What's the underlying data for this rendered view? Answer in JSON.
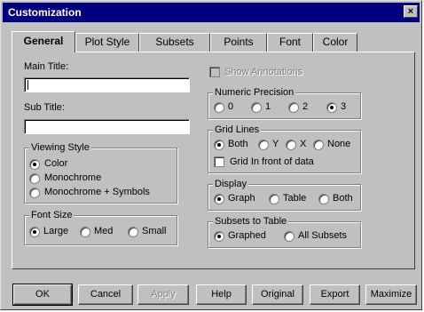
{
  "window": {
    "title": "Customization",
    "close_glyph": "×"
  },
  "tabs": [
    {
      "label": "General",
      "active": true
    },
    {
      "label": "Plot Style"
    },
    {
      "label": "Subsets"
    },
    {
      "label": "Points"
    },
    {
      "label": "Font"
    },
    {
      "label": "Color"
    }
  ],
  "general": {
    "main_title": {
      "label": "Main Title:",
      "value": ""
    },
    "sub_title": {
      "label": "Sub Title:",
      "value": ""
    },
    "show_annotations": {
      "label": "Show Annotations",
      "checked": false,
      "enabled": false
    },
    "viewing_style": {
      "legend": "Viewing Style",
      "options": [
        "Color",
        "Monochrome",
        "Monochrome + Symbols"
      ],
      "selected": "Color"
    },
    "font_size": {
      "legend": "Font Size",
      "options": [
        "Large",
        "Med",
        "Small"
      ],
      "selected": "Large"
    },
    "numeric_precision": {
      "legend": "Numeric Precision",
      "options": [
        "0",
        "1",
        "2",
        "3"
      ],
      "selected": "3"
    },
    "grid_lines": {
      "legend": "Grid Lines",
      "options": [
        "Both",
        "Y",
        "X",
        "None"
      ],
      "selected": "Both",
      "front_label": "Grid In front of data",
      "front_checked": false
    },
    "display": {
      "legend": "Display",
      "options": [
        "Graph",
        "Table",
        "Both"
      ],
      "selected": "Graph"
    },
    "subsets_to_table": {
      "legend": "Subsets to Table",
      "options": [
        "Graphed",
        "All Subsets"
      ],
      "selected": "Graphed"
    }
  },
  "buttons": {
    "ok": "OK",
    "cancel": "Cancel",
    "apply": "Apply",
    "help": "Help",
    "original": "Original",
    "export": "Export",
    "maximize": "Maximize"
  }
}
